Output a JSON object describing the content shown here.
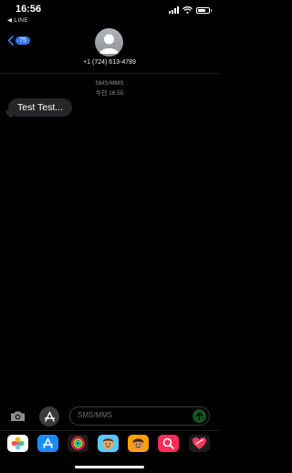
{
  "status_bar": {
    "time": "16:56",
    "back_app": "◀ LINE",
    "signal_bars": 4,
    "battery_level": 0.75
  },
  "header": {
    "back_badge": "75",
    "contact_number": "+1 (724) 613-4789"
  },
  "conversation": {
    "service_label": "SMS/MMS",
    "date_label": "今日 16:55",
    "messages": [
      {
        "direction": "incoming",
        "text": "Test Test..."
      }
    ]
  },
  "composer": {
    "placeholder": "SMS/MMS"
  },
  "app_strip": {
    "items": [
      {
        "icon": "photos-icon"
      },
      {
        "icon": "app-store-icon"
      },
      {
        "icon": "activity-icon"
      },
      {
        "icon": "memoji-icon"
      },
      {
        "icon": "memoji-sticker-icon"
      },
      {
        "icon": "image-search-icon"
      },
      {
        "icon": "digital-touch-icon"
      }
    ]
  },
  "colors": {
    "accent": "#3478f6",
    "bubble": "#262629",
    "send": "#30d158"
  }
}
